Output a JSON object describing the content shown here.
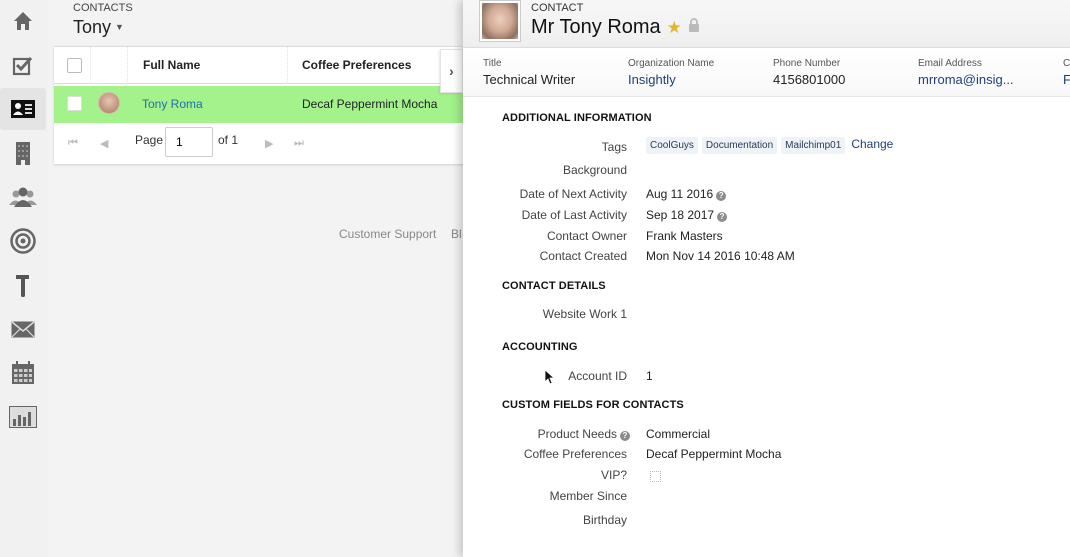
{
  "nav": {
    "items": [
      {
        "name": "home",
        "icon": "home-icon",
        "active": false
      },
      {
        "name": "tasks",
        "icon": "checkbox-icon",
        "active": false
      },
      {
        "name": "contacts",
        "icon": "contact-card-icon",
        "active": true
      },
      {
        "name": "organizations",
        "icon": "building-icon",
        "active": false
      },
      {
        "name": "leads",
        "icon": "people-icon",
        "active": false
      },
      {
        "name": "opportunities",
        "icon": "target-icon",
        "active": false
      },
      {
        "name": "projects",
        "icon": "hammer-icon",
        "active": false
      },
      {
        "name": "emails",
        "icon": "envelope-icon",
        "active": false
      },
      {
        "name": "calendar",
        "icon": "calendar-icon",
        "active": false
      },
      {
        "name": "reports",
        "icon": "bar-chart-icon",
        "active": false
      }
    ]
  },
  "list": {
    "kicker": "CONTACTS",
    "view_name": "Tony",
    "columns": [
      "Full Name",
      "Coffee Preferences"
    ],
    "rows": [
      {
        "full_name": "Tony Roma",
        "coffee_preferences": "Decaf Peppermint Mocha",
        "selected": false
      }
    ],
    "pager": {
      "page_label": "Page",
      "current": "1",
      "of_label": "of 1"
    }
  },
  "footer_links": [
    "Customer Support",
    "Bl"
  ],
  "detail": {
    "kicker": "CONTACT",
    "name": "Mr Tony Roma",
    "starred": true,
    "summary": [
      {
        "label": "Title",
        "value": "Technical Writer",
        "link": false
      },
      {
        "label": "Organization Name",
        "value": "Insightly",
        "link": true
      },
      {
        "label": "Phone Number",
        "value": "4156801000",
        "link": false
      },
      {
        "label": "Email Address",
        "value": "mrroma@insig...",
        "link": true
      },
      {
        "label": "C",
        "value": "F",
        "link": true
      }
    ],
    "sections": {
      "additional": {
        "title": "ADDITIONAL INFORMATION",
        "tags_label": "Tags",
        "tags": [
          "CoolGuys",
          "Documentation",
          "Mailchimp01"
        ],
        "change_label": "Change",
        "background_label": "Background",
        "next_activity_label": "Date of Next Activity",
        "next_activity": "Aug 11 2016",
        "last_activity_label": "Date of Last Activity",
        "last_activity": "Sep 18 2017",
        "owner_label": "Contact Owner",
        "owner": "Frank Masters",
        "created_label": "Contact Created",
        "created": "Mon Nov 14 2016 10:48 AM"
      },
      "contact_details": {
        "title": "CONTACT DETAILS",
        "website_label": "Website Work 1"
      },
      "accounting": {
        "title": "ACCOUNTING",
        "account_id_label": "Account ID",
        "account_id": "1"
      },
      "custom": {
        "title": "CUSTOM FIELDS FOR CONTACTS",
        "product_needs_label": "Product Needs",
        "product_needs": "Commercial",
        "coffee_label": "Coffee Preferences",
        "coffee": "Decaf Peppermint Mocha",
        "vip_label": "VIP?",
        "vip": false,
        "member_since_label": "Member Since",
        "birthday_label": "Birthday"
      }
    }
  },
  "colors": {
    "selected_row": "#a3f28c",
    "link": "#1d3f7a",
    "star": "#e3b62b"
  }
}
